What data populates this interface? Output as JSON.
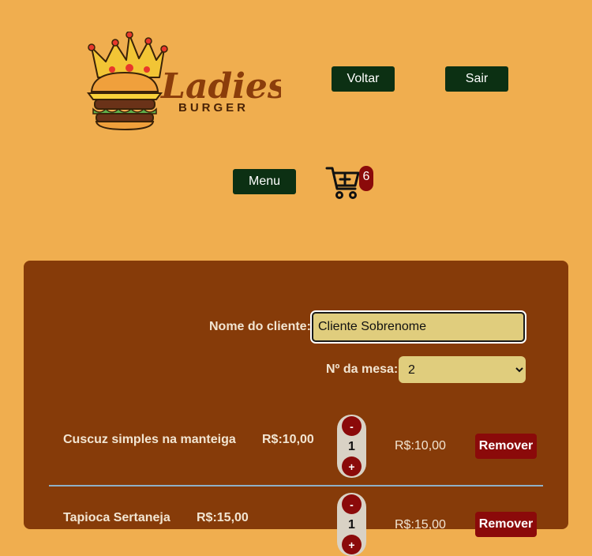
{
  "brand": {
    "name": "Ladies",
    "sub": "BURGER"
  },
  "header": {
    "back_label": "Voltar",
    "exit_label": "Sair",
    "menu_label": "Menu"
  },
  "cart": {
    "count": "6"
  },
  "form": {
    "client_label": "Nome do cliente:",
    "client_value": "Cliente Sobrenome",
    "table_label": "Nº da mesa:",
    "table_value": "2"
  },
  "order_items": [
    {
      "name": "Cuscuz simples na manteiga",
      "price": "R$:10,00",
      "qty": "1",
      "total": "R$:10,00",
      "remove_label": "Remover",
      "minus": "-",
      "plus": "+"
    },
    {
      "name": "Tapioca Sertaneja",
      "price": "R$:15,00",
      "qty": "1",
      "total": "R$:15,00",
      "remove_label": "Remover",
      "minus": "-",
      "plus": "+"
    }
  ],
  "colors": {
    "background": "#f0ae4f",
    "panel": "#863b09",
    "button_green": "#0c3013",
    "accent_red": "#8b0a0a",
    "field": "#e0cd7d"
  }
}
